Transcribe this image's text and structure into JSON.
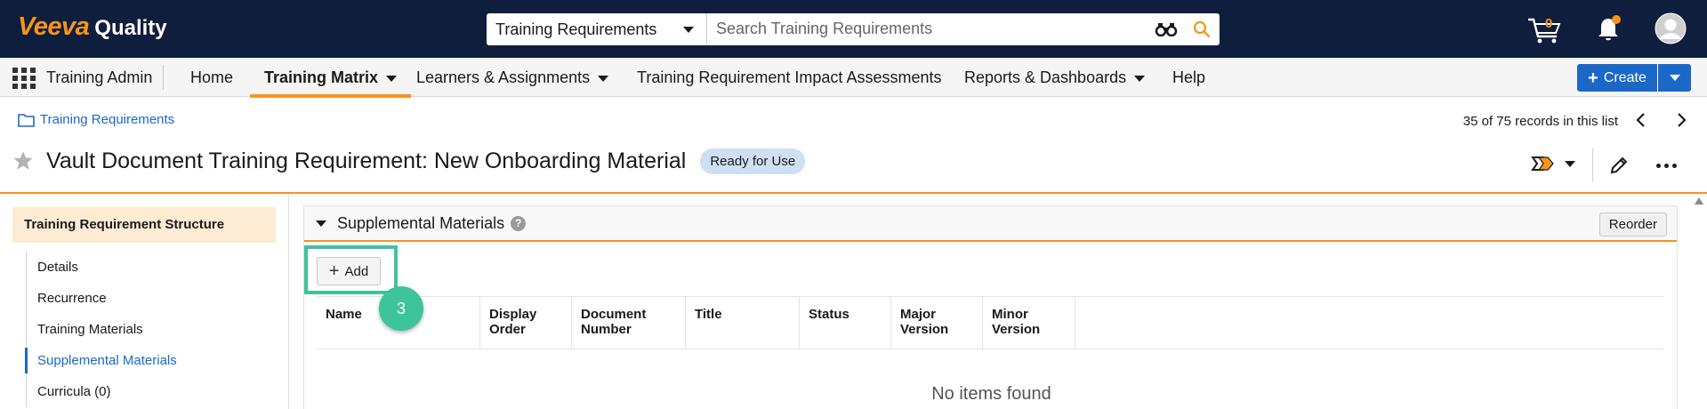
{
  "app": {
    "brand": "Veeva",
    "product": "Quality"
  },
  "search": {
    "scope": "Training Requirements",
    "placeholder": "Search Training Requirements"
  },
  "header_icons": {
    "cart_count": "0"
  },
  "nav": {
    "app_name": "Training Admin",
    "items": [
      {
        "label": "Home",
        "dropdown": false
      },
      {
        "label": "Training Matrix",
        "dropdown": true,
        "active": true
      },
      {
        "label": "Learners & Assignments",
        "dropdown": true
      },
      {
        "label": "Training Requirement Impact Assessments",
        "dropdown": false
      },
      {
        "label": "Reports & Dashboards",
        "dropdown": true
      },
      {
        "label": "Help",
        "dropdown": false
      }
    ],
    "create_label": "Create"
  },
  "breadcrumb": {
    "label": "Training Requirements"
  },
  "records": {
    "text": "35 of 75 records in this list"
  },
  "record": {
    "title": "Vault Document Training Requirement: New Onboarding Material",
    "status": "Ready for Use"
  },
  "sidebar": {
    "heading": "Training Requirement Structure",
    "items": [
      {
        "label": "Details"
      },
      {
        "label": "Recurrence"
      },
      {
        "label": "Training Materials"
      },
      {
        "label": "Supplemental Materials",
        "selected": true
      },
      {
        "label": "Curricula (0)"
      }
    ]
  },
  "section": {
    "title": "Supplemental Materials",
    "help": "?",
    "reorder_label": "Reorder",
    "add_label": "Add",
    "step_number": "3",
    "columns": [
      "Name",
      "Display Order",
      "Document Number",
      "Title",
      "Status",
      "Major Version",
      "Minor Version"
    ],
    "empty_text": "No items found"
  },
  "colors": {
    "accent": "#f7941d",
    "primary": "#1b68c9",
    "topbar": "#0e1e3c",
    "highlight": "#3ec49a"
  }
}
